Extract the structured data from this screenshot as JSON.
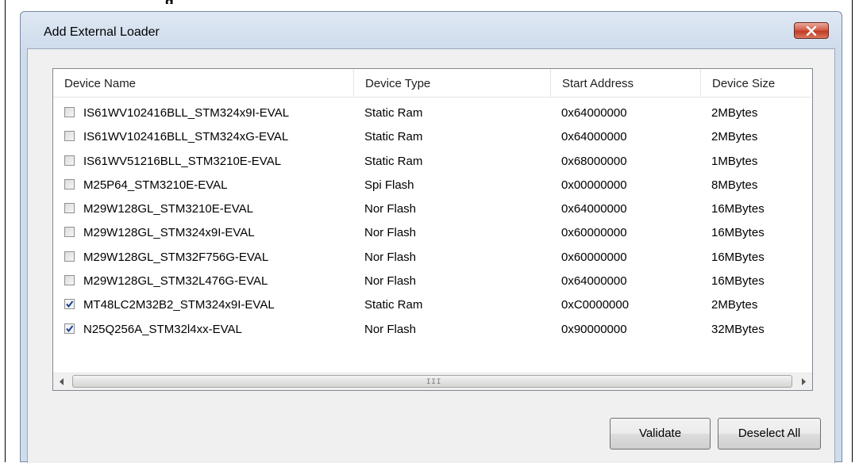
{
  "window": {
    "title": "Add External Loader",
    "caption_fragment": "g"
  },
  "list": {
    "columns": [
      "Device Name",
      "Device Type",
      "Start Address",
      "Device Size"
    ],
    "rows": [
      {
        "checked": false,
        "name": "IS61WV102416BLL_STM324x9I-EVAL",
        "type": "Static Ram",
        "address": "0x64000000",
        "size": "2MBytes"
      },
      {
        "checked": false,
        "name": "IS61WV102416BLL_STM324xG-EVAL",
        "type": "Static Ram",
        "address": "0x64000000",
        "size": "2MBytes"
      },
      {
        "checked": false,
        "name": "IS61WV51216BLL_STM3210E-EVAL",
        "type": "Static Ram",
        "address": "0x68000000",
        "size": "1MBytes"
      },
      {
        "checked": false,
        "name": "M25P64_STM3210E-EVAL",
        "type": "Spi Flash",
        "address": "0x00000000",
        "size": "8MBytes"
      },
      {
        "checked": false,
        "name": "M29W128GL_STM3210E-EVAL",
        "type": "Nor Flash",
        "address": "0x64000000",
        "size": "16MBytes"
      },
      {
        "checked": false,
        "name": "M29W128GL_STM324x9I-EVAL",
        "type": "Nor Flash",
        "address": "0x60000000",
        "size": "16MBytes"
      },
      {
        "checked": false,
        "name": "M29W128GL_STM32F756G-EVAL",
        "type": "Nor Flash",
        "address": "0x60000000",
        "size": "16MBytes"
      },
      {
        "checked": false,
        "name": "M29W128GL_STM32L476G-EVAL",
        "type": "Nor Flash",
        "address": "0x64000000",
        "size": "16MBytes"
      },
      {
        "checked": true,
        "name": "MT48LC2M32B2_STM324x9I-EVAL",
        "type": "Static Ram",
        "address": "0xC0000000",
        "size": "2MBytes"
      },
      {
        "checked": true,
        "name": "N25Q256A_STM32l4xx-EVAL",
        "type": "Nor Flash",
        "address": "0x90000000",
        "size": "32MBytes"
      }
    ]
  },
  "scrollbar": {
    "grip": "III"
  },
  "buttons": {
    "validate": "Validate",
    "deselect_all": "Deselect All"
  },
  "icons": {
    "close": "close-icon",
    "scroll_left": "arrow-left-icon",
    "scroll_right": "arrow-right-icon",
    "check": "checkmark-icon"
  },
  "colors": {
    "close_button": "#c9432b",
    "titlebar": "#cfdcec",
    "check": "#1c3f94"
  }
}
